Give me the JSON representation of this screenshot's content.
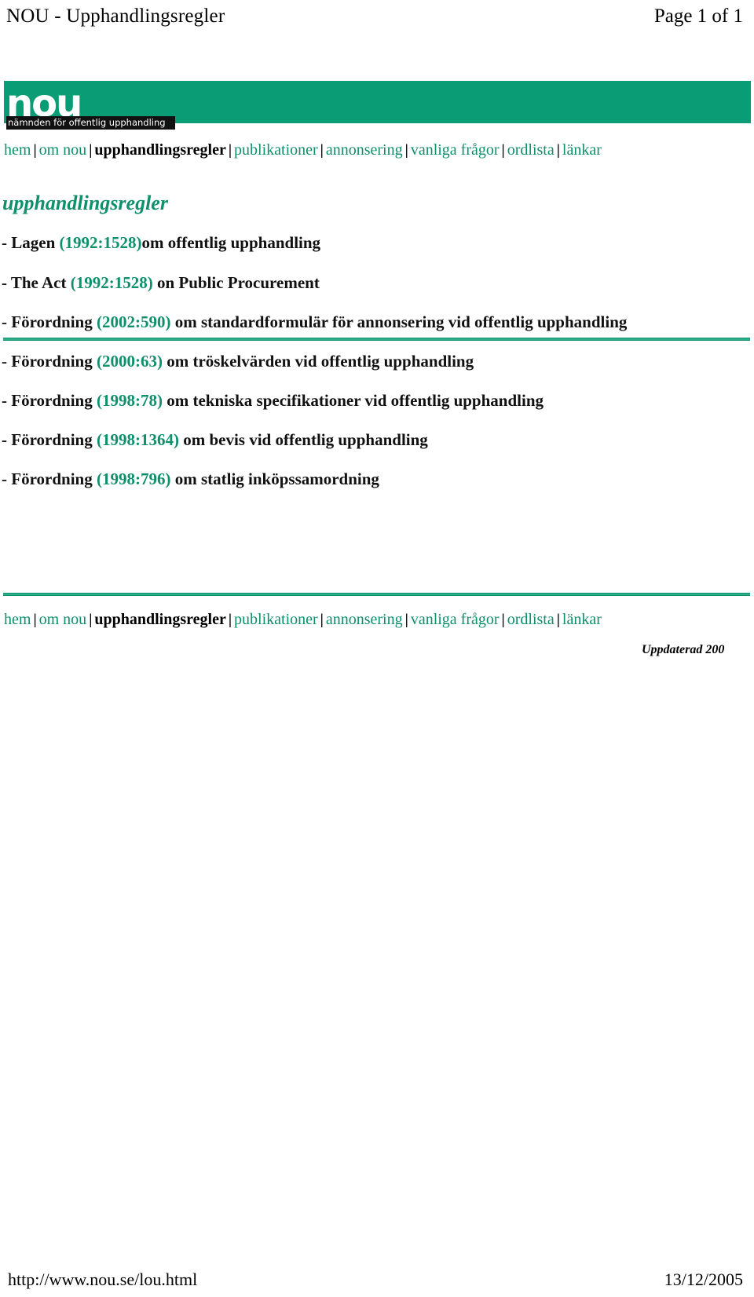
{
  "print_header": {
    "title": "NOU - Upphandlingsregler",
    "page_indicator": "Page 1 of 1"
  },
  "banner": {
    "logo_text": "nou",
    "tagline": "nämnden för offentlig upphandling",
    "green": "#0a9c74",
    "link_green": "#0f8f6b"
  },
  "nav": {
    "separator": "|",
    "items": [
      {
        "label": "hem",
        "current": false
      },
      {
        "label": "om nou",
        "current": false
      },
      {
        "label": "upphandlingsregler",
        "current": true
      },
      {
        "label": "publikationer",
        "current": false
      },
      {
        "label": "annonsering",
        "current": false
      },
      {
        "label": "vanliga frågor",
        "current": false
      },
      {
        "label": "ordlista",
        "current": false
      },
      {
        "label": "länkar",
        "current": false
      }
    ]
  },
  "main": {
    "title": "upphandlingsregler",
    "items": [
      {
        "prefix": "- Lagen ",
        "code": "(1992:1528)",
        "suffix": "om offentlig upphandling"
      },
      {
        "prefix": "- The Act ",
        "code": "(1992:1528)",
        "suffix": " on Public Procurement"
      },
      {
        "prefix": "- Förordning ",
        "code": "(2002:590)",
        "suffix": " om standardformulär för annonsering vid offentlig upphandling"
      },
      {
        "prefix": "- Förordning ",
        "code": "(2000:63)",
        "suffix": "  om tröskelvärden vid offentlig upphandling"
      },
      {
        "prefix": "- Förordning ",
        "code": "(1998:78)",
        "suffix": " om tekniska specifikationer vid offentlig upphandling"
      },
      {
        "prefix": "- Förordning ",
        "code": "(1998:1364)",
        "suffix": " om bevis vid offentlig upphandling"
      },
      {
        "prefix": "- Förordning ",
        "code": "(1998:796)",
        "suffix": " om statlig inköpssamordning"
      }
    ]
  },
  "footer": {
    "updated_label": "Uppdaterad 200"
  },
  "print_footer": {
    "url": "http://www.nou.se/lou.html",
    "date": "13/12/2005"
  }
}
